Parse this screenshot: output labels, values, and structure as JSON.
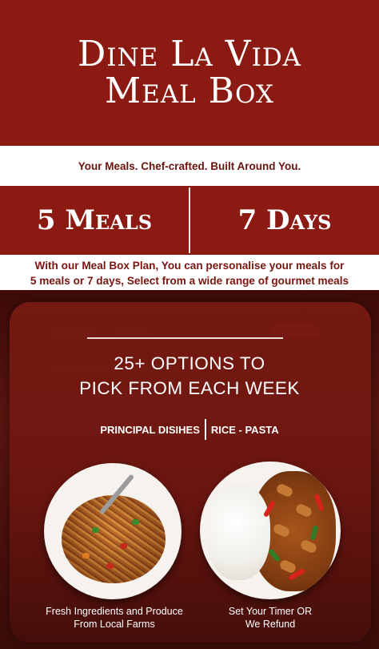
{
  "header": {
    "title_line1": "Dine La Vida",
    "title_line2": "Meal Box"
  },
  "tagline": "Your Meals. Chef-crafted. Built Around You.",
  "plans": [
    {
      "label": "5 Meals"
    },
    {
      "label": "7 Days"
    }
  ],
  "description": {
    "line1": "With our Meal Box Plan, You can personalise your meals for",
    "line2": "5 meals or 7 days, Select from a wide range of gourmet meals"
  },
  "options": {
    "line1": "25+ OPTIONS TO",
    "line2": "PICK FROM EACH WEEK"
  },
  "categories": [
    {
      "label": "PRINCIPAL DISIHES"
    },
    {
      "label": "RICE - PASTA"
    }
  ],
  "features": [
    {
      "line1": "Fresh Ingredients and Produce",
      "line2": "From Local Farms",
      "icon": "noodles-plate-image"
    },
    {
      "line1": "Set Your Timer OR",
      "line2": "We Refund",
      "icon": "rice-chicken-plate-image"
    }
  ],
  "colors": {
    "brand_red": "#8b1a12",
    "dark_red": "#4a0f0c",
    "white": "#ffffff"
  }
}
